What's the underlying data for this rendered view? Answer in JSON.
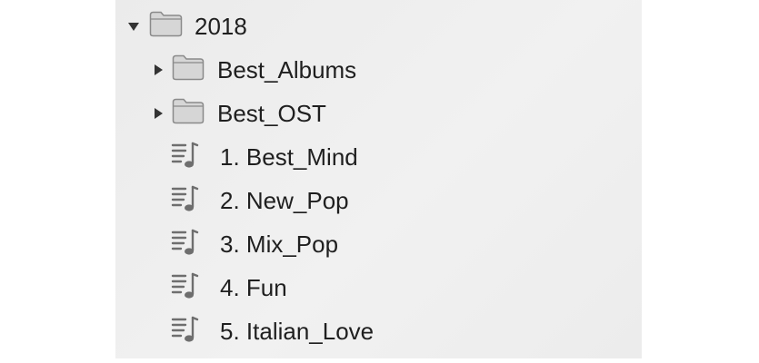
{
  "tree": {
    "root": {
      "label": "2018",
      "expanded": true,
      "icon": "folder-icon"
    },
    "children": [
      {
        "label": "Best_Albums",
        "type": "folder",
        "expanded": false,
        "icon": "folder-icon"
      },
      {
        "label": "Best_OST",
        "type": "folder",
        "expanded": false,
        "icon": "folder-icon"
      },
      {
        "label": "1. Best_Mind",
        "type": "playlist",
        "icon": "playlist-icon"
      },
      {
        "label": "2. New_Pop",
        "type": "playlist",
        "icon": "playlist-icon"
      },
      {
        "label": "3. Mix_Pop",
        "type": "playlist",
        "icon": "playlist-icon"
      },
      {
        "label": "4. Fun",
        "type": "playlist",
        "icon": "playlist-icon"
      },
      {
        "label": "5. Italian_Love",
        "type": "playlist",
        "icon": "playlist-icon"
      }
    ]
  },
  "colors": {
    "panel_background": "#eeeeee",
    "text": "#1f1f1f",
    "icon": "#6e6e6e",
    "folder_fill": "#d4d4d4",
    "folder_stroke": "#8a8a8a"
  }
}
